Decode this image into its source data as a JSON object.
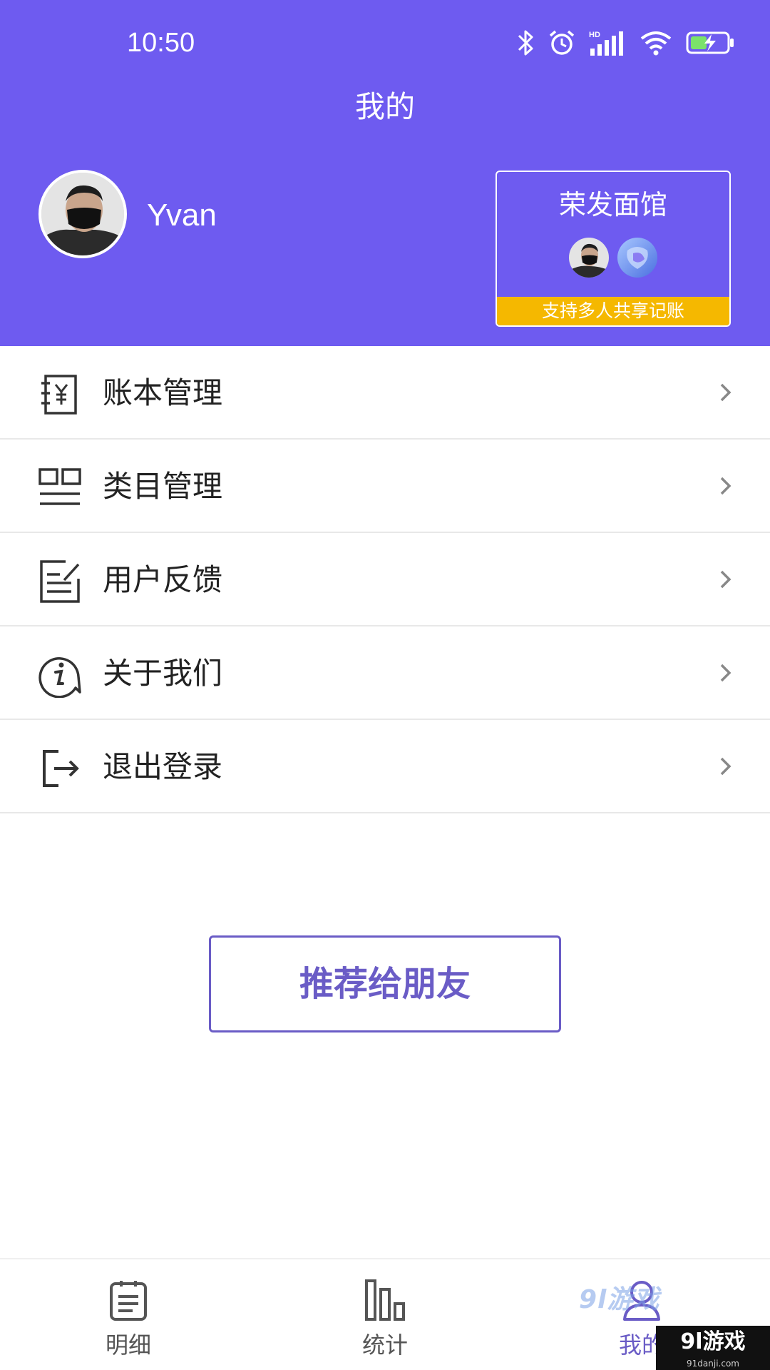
{
  "status_bar": {
    "time": "10:50",
    "icons": [
      "bluetooth-icon",
      "alarm-icon",
      "hd-signal-icon",
      "wifi-icon",
      "battery-charging-icon"
    ]
  },
  "header": {
    "title": "我的",
    "background_color": "#6e5bf0"
  },
  "user": {
    "name": "Yvan"
  },
  "book_card": {
    "name": "荣发面馆",
    "share_text": "支持多人共享记账",
    "strip_color": "#f5b800",
    "member_count": 2
  },
  "menu": {
    "items": [
      {
        "label": "账本管理",
        "icon": "ledger-yuan-icon"
      },
      {
        "label": "类目管理",
        "icon": "category-grid-icon"
      },
      {
        "label": "用户反馈",
        "icon": "feedback-note-icon"
      },
      {
        "label": "关于我们",
        "icon": "info-bubble-icon"
      },
      {
        "label": "退出登录",
        "icon": "logout-icon"
      }
    ]
  },
  "recommend": {
    "label": "推荐给朋友",
    "accent_color": "#6a5cc6"
  },
  "tabbar": {
    "tabs": [
      {
        "label": "明细",
        "icon": "clipboard-list-icon",
        "active": false
      },
      {
        "label": "统计",
        "icon": "bar-chart-icon",
        "active": false
      },
      {
        "label": "我的",
        "icon": "person-icon",
        "active": true
      }
    ]
  },
  "watermark": {
    "tab_text": "9l游戏",
    "corner_text": "9l游戏",
    "corner_sub": "91danji.com"
  }
}
